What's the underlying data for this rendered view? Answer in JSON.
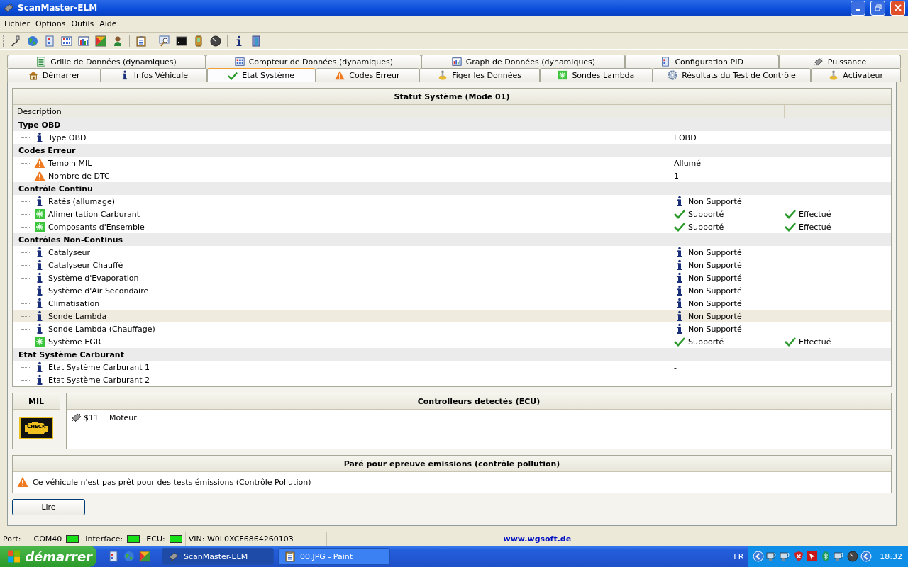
{
  "window": {
    "title": "ScanMaster-ELM"
  },
  "menu": [
    "Fichier",
    "Options",
    "Outils",
    "Aide"
  ],
  "tab_rows": [
    [
      {
        "label": "Grille de Données (dynamiques)",
        "selected": false
      },
      {
        "label": "Compteur de Données (dynamiques)",
        "selected": false
      },
      {
        "label": "Graph de Données (dynamiques)",
        "selected": false
      },
      {
        "label": "Configuration PID",
        "selected": false
      },
      {
        "label": "Puissance",
        "selected": false
      }
    ],
    [
      {
        "label": "Démarrer",
        "selected": false
      },
      {
        "label": "Infos Véhicule",
        "selected": false
      },
      {
        "label": "Etat Système",
        "selected": true
      },
      {
        "label": "Codes Erreur",
        "selected": false
      },
      {
        "label": "Figer les Données",
        "selected": false
      },
      {
        "label": "Sondes Lambda",
        "selected": false
      },
      {
        "label": "Résultats du Test de Contrôle",
        "selected": false
      },
      {
        "label": "Activateur",
        "selected": false
      }
    ]
  ],
  "status_table": {
    "title": "Statut Système (Mode 01)",
    "columns": [
      "Description"
    ],
    "groups": [
      {
        "label": "Type OBD",
        "children": [
          {
            "label": "Type OBD",
            "kind": "info",
            "selected": false,
            "value": "EOBD"
          }
        ]
      },
      {
        "label": "Codes Erreur",
        "children": [
          {
            "label": "Temoin MIL",
            "kind": "warning",
            "selected": false,
            "value": "Allumé"
          },
          {
            "label": "Nombre de DTC",
            "kind": "warning",
            "selected": false,
            "value": "1"
          }
        ]
      },
      {
        "label": "Contrôle Continu",
        "children": [
          {
            "label": "Ratés (allumage)",
            "kind": "info",
            "selected": false,
            "support": "Non Supporté",
            "supported": false
          },
          {
            "label": "Alimentation Carburant",
            "kind": "sensor",
            "selected": false,
            "support": "Supporté",
            "supported": true,
            "result": "Effectué"
          },
          {
            "label": "Composants d'Ensemble",
            "kind": "sensor",
            "selected": false,
            "support": "Supporté",
            "supported": true,
            "result": "Effectué"
          }
        ]
      },
      {
        "label": "Contrôles Non-Continus",
        "children": [
          {
            "label": "Catalyseur",
            "kind": "info",
            "selected": false,
            "support": "Non Supporté",
            "supported": false
          },
          {
            "label": "Catalyseur Chauffé",
            "kind": "info",
            "selected": false,
            "support": "Non Supporté",
            "supported": false
          },
          {
            "label": "Système d'Evaporation",
            "kind": "info",
            "selected": false,
            "support": "Non Supporté",
            "supported": false
          },
          {
            "label": "Système d'Air Secondaire",
            "kind": "info",
            "selected": false,
            "support": "Non Supporté",
            "supported": false
          },
          {
            "label": "Climatisation",
            "kind": "info",
            "selected": false,
            "support": "Non Supporté",
            "supported": false
          },
          {
            "label": "Sonde Lambda",
            "kind": "info",
            "selected": true,
            "support": "Non Supporté",
            "supported": false
          },
          {
            "label": "Sonde Lambda (Chauffage)",
            "kind": "info",
            "selected": false,
            "support": "Non Supporté",
            "supported": false
          },
          {
            "label": "Système EGR",
            "kind": "sensor",
            "selected": false,
            "support": "Supporté",
            "supported": true,
            "result": "Effectué"
          }
        ]
      },
      {
        "label": "Etat Système Carburant",
        "children": [
          {
            "label": "Etat Système Carburant 1",
            "kind": "info",
            "selected": false,
            "value": "-"
          },
          {
            "label": "Etat Système Carburant 2",
            "kind": "info",
            "selected": false,
            "value": "-"
          }
        ]
      }
    ]
  },
  "mil": {
    "title": "MIL",
    "lamp_text": "CHECK",
    "on": true
  },
  "controllers": {
    "title": "Controlleurs detectés (ECU)",
    "rows": [
      {
        "address": "$11",
        "name": "Moteur"
      }
    ]
  },
  "emissions": {
    "title": "Paré pour epreuve emissions (contrôle pollution)",
    "message": "Ce véhicule n'est pas prêt pour des tests émissions (Contrôle Pollution)"
  },
  "read_button": "Lire",
  "status_bar": {
    "port_label": "Port:",
    "port": "COM40",
    "port_on": true,
    "interface_label": "Interface:",
    "interface_on": true,
    "ecu_label": "ECU:",
    "ecu_on": true,
    "vin": "VIN: W0L0XCF6864260103",
    "link": "www.wgsoft.de"
  },
  "taskbar": {
    "start": "démarrer",
    "tasks": [
      {
        "label": "ScanMaster-ELM",
        "selected": true
      },
      {
        "label": "00.JPG - Paint",
        "selected": false
      }
    ],
    "language": "FR",
    "clock": "18:32"
  }
}
